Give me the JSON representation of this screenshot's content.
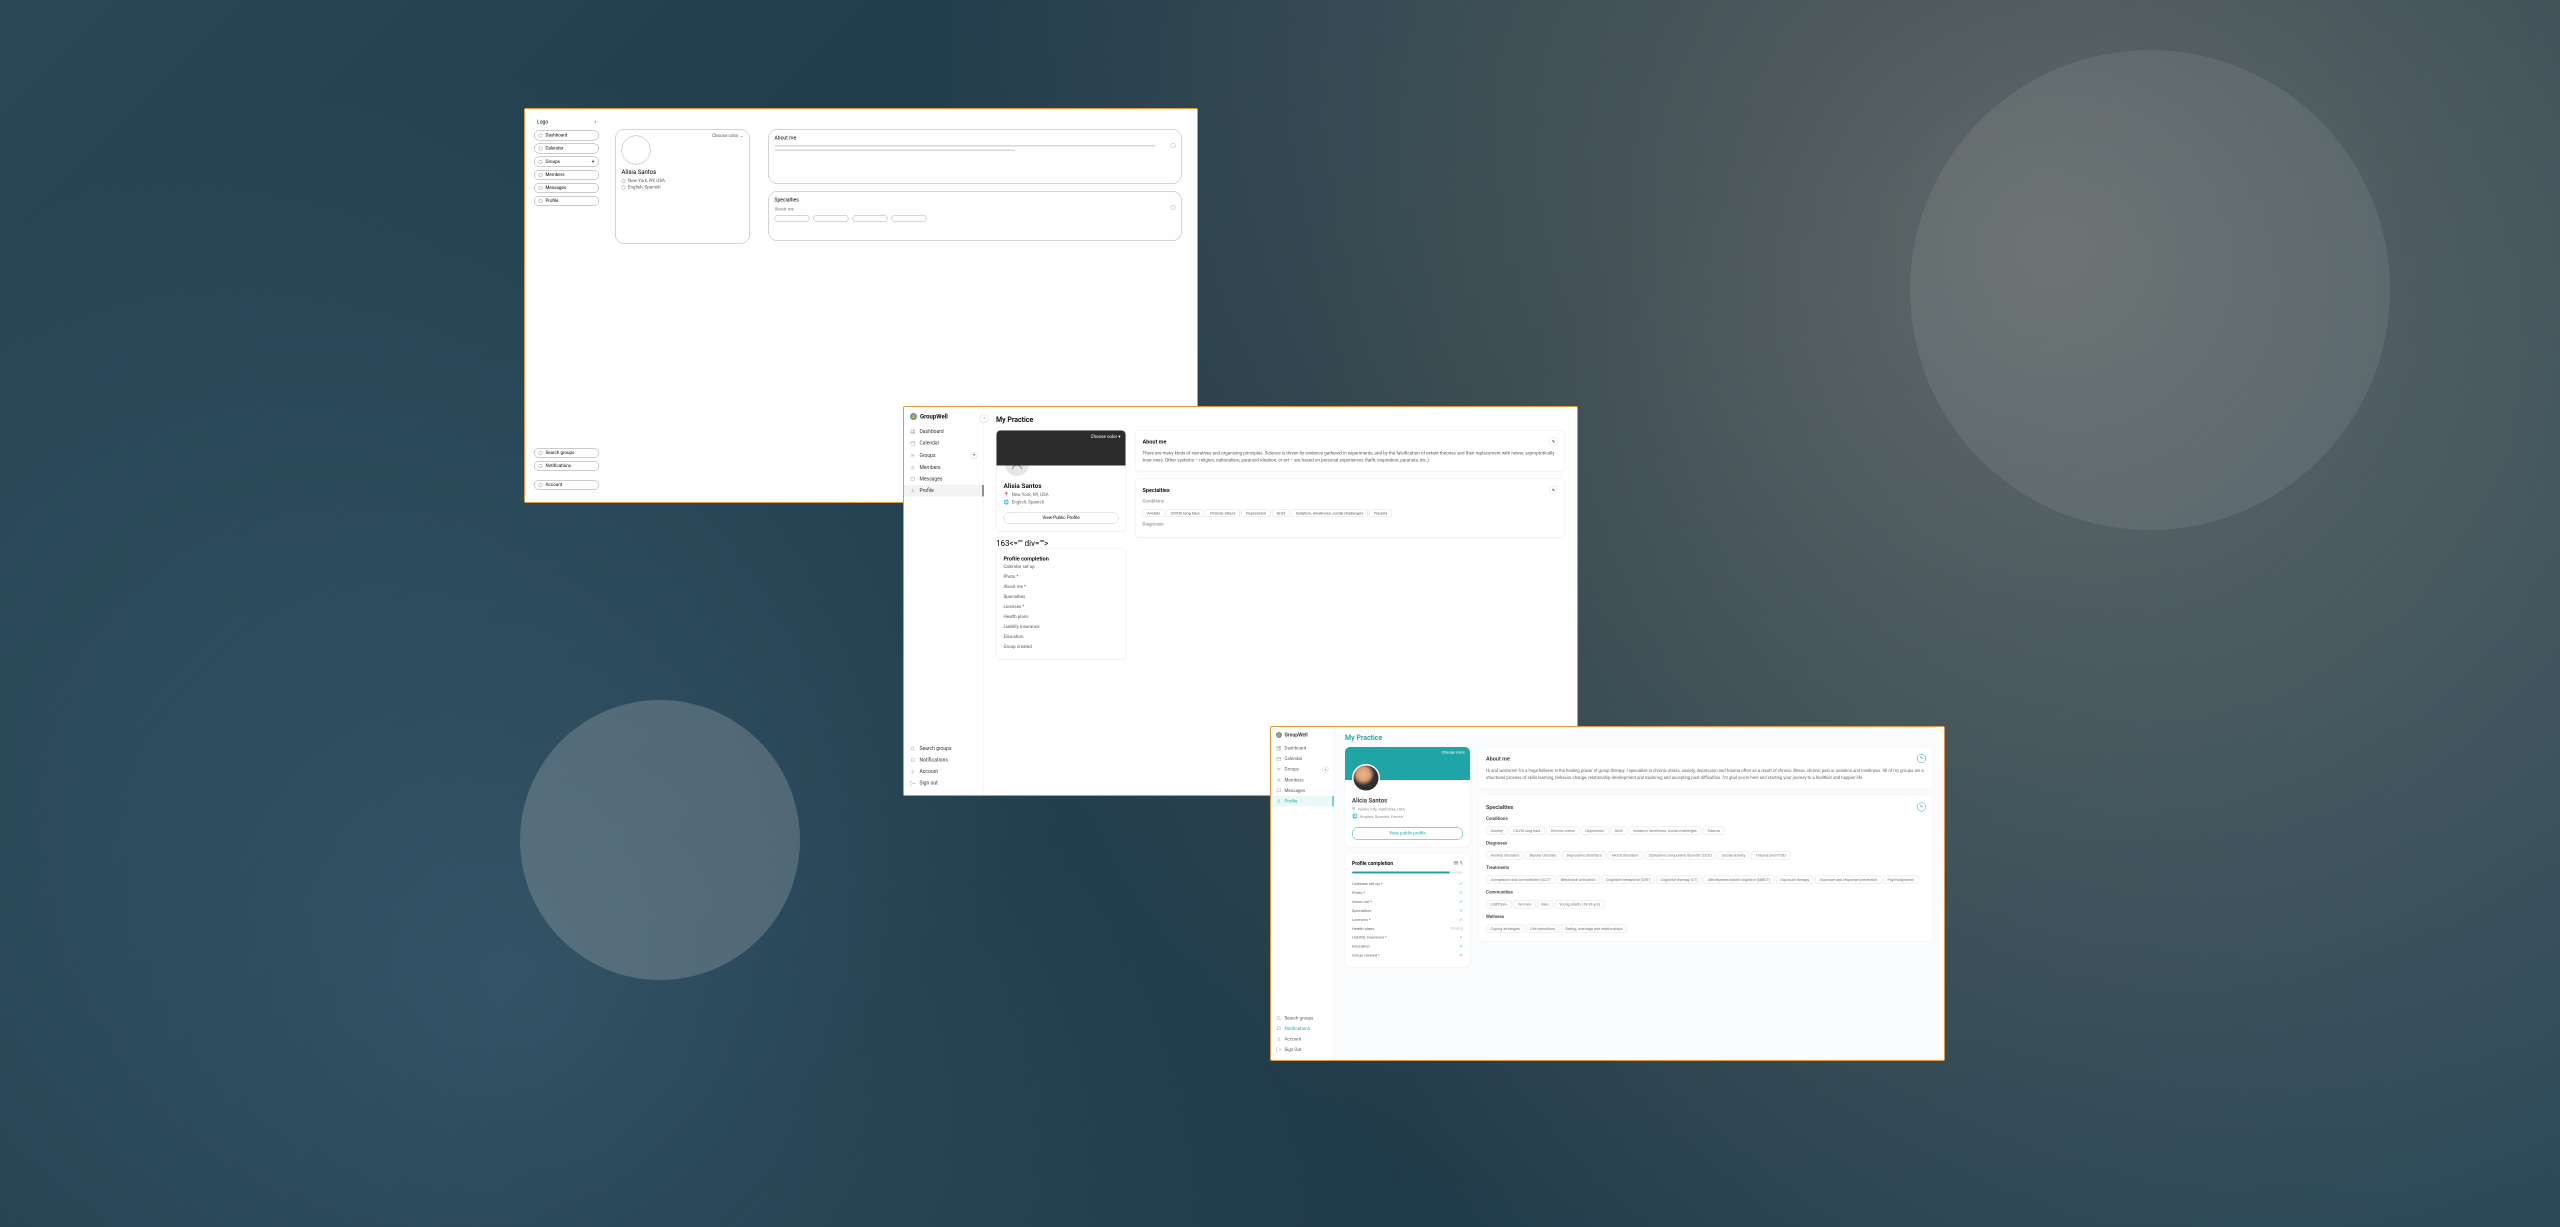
{
  "wireframe": {
    "logo": "Logo",
    "nav": [
      "Dashboard",
      "Calendar",
      "Groups",
      "Members",
      "Messages",
      "Profile"
    ],
    "bottom_nav": [
      "Search groups",
      "Notifications",
      "Account"
    ],
    "profile_name": "Alisia Santos",
    "meta_location": "New York, NY, USA",
    "meta_lang": "English, Spanish",
    "choose_color": "Choose color",
    "about_title": "About me",
    "specialties_title": "Specialties",
    "sub_about": "About me"
  },
  "mid": {
    "brand": "GroupWell",
    "nav": [
      "Dashboard",
      "Calendar",
      "Groups",
      "Members",
      "Messages",
      "Profile"
    ],
    "bottom_nav": [
      "Search groups",
      "Notifications",
      "Account",
      "Sign out"
    ],
    "page_title": "My Practice",
    "choose_color": "Choose color",
    "profile_name": "Alisia Santos",
    "meta_location": "New York, NY, USA",
    "meta_lang": "English, Spanish",
    "view_profile": "View Public Profile",
    "completion_title": "Profile completion",
    "checklist": [
      "Calendar set up",
      "Photo",
      "About me",
      "Specialties",
      "Licenses",
      "Health plans",
      "Liability insurance",
      "Education",
      "Group created"
    ],
    "about_title": "About me",
    "about_body": "There are many kinds of narratives and organizing principles. Science is driven by evidence gathered in experiments, and by the falsification of extant theories and their replacement with newer, asymptotically truer ones. Other systems – religion, nationalism, paranoid ideation, or art – are based on personal experiences (faith, inspiration, paranoia, etc.).",
    "specialties_title": "Specialties",
    "conditions_label": "Conditions",
    "conditions": [
      "Anxiety",
      "COVID long haul",
      "Chronic stress",
      "Depression",
      "Grief",
      "Isolation, loneliness, social challenges",
      "Trauma"
    ],
    "diagnoses_label": "Diagnoses"
  },
  "hi": {
    "brand": "GroupWell",
    "nav": [
      "Dashboard",
      "Calendar",
      "Groups",
      "Members",
      "Messages",
      "Profile"
    ],
    "bottom_nav": [
      "Search groups",
      "Notifications",
      "Account",
      "Sign Out"
    ],
    "page_title": "My Practice",
    "change_color": "Change color",
    "profile_name": "Alicia Santos",
    "meta_location": "Foster City, California, USA",
    "meta_lang": "English, Spanish, French",
    "view_profile": "View public profile",
    "completion_title": "Profile completion",
    "completion_pct": "88 %",
    "checklist": [
      {
        "label": "Calendar set up",
        "req": true,
        "done": true
      },
      {
        "label": "Photo",
        "req": true,
        "done": true
      },
      {
        "label": "About me",
        "req": true,
        "done": true
      },
      {
        "label": "Specialties",
        "req": false,
        "done": true
      },
      {
        "label": "Licences",
        "req": true,
        "done": true
      },
      {
        "label": "Health plans",
        "req": false,
        "done": false,
        "status": "Pending"
      },
      {
        "label": "Liability insurance",
        "req": true,
        "done": true
      },
      {
        "label": "Education",
        "req": false,
        "done": true
      },
      {
        "label": "Group created",
        "req": true,
        "done": true
      }
    ],
    "about_title": "About me",
    "about_body": "Hi and welcome! I'm a huge believer in the healing power of group therapy. I specialize in chronic stress, anxiety, depression and trauma often as a result of chronic illness, chronic pain or isolation and loneliness. All of my groups are a structured process of skills learning, behavior change, relationship development and exploring and accepting past difficulties. I'm glad you're here and starting your journey to a healthier and happier life.",
    "specialties_title": "Specialties",
    "conditions_label": "Conditions",
    "conditions": [
      "Anxiety",
      "COVID long haul",
      "Chronic stress",
      "Depression",
      "Grief",
      "Isolation, loneliness, social challenges",
      "Trauma"
    ],
    "diagnoses_label": "Diagnoses",
    "diagnoses": [
      "Anxiety disorders",
      "Bipolar disorder",
      "Depressive disorders",
      "Mood disorders",
      "Obsessive compulsive disorder (OCD)",
      "Social anxiety",
      "Trauma and PTSD"
    ],
    "treatments_label": "Treatments",
    "treatments": [
      "Acceptance and commitment (ACT)",
      "Behavioral activation",
      "Cognitive behavioral (CBT)",
      "Cognitive therapy (CT)",
      "Mindfulness-based cognitive (MBCT)",
      "Exposure therapy",
      "Exposure and response prevention",
      "Psychodynamic"
    ],
    "communities_label": "Communities",
    "communities": [
      "LGBTQIA+",
      "Women",
      "Men",
      "Young adults (18-24 y/o)"
    ],
    "wellness_label": "Wellness",
    "wellness": [
      "Coping strategies",
      "Life transitions",
      "Dating, marriage and relationships"
    ]
  }
}
